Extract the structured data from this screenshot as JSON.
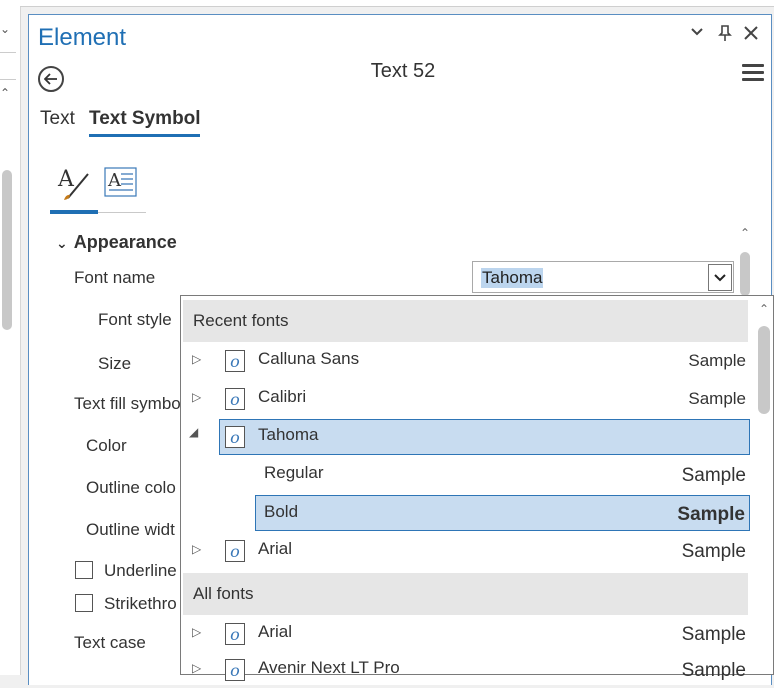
{
  "panel": {
    "title": "Element",
    "subtitle": "Text 52",
    "tabs": [
      {
        "label": "Text"
      },
      {
        "label": "Text Symbol"
      }
    ],
    "section": "Appearance",
    "properties": {
      "font_name": "Font name",
      "font_style": "Font style",
      "size": "Size",
      "text_fill_symbol": "Text fill symbo",
      "color": "Color",
      "outline_color": "Outline colo",
      "outline_width": "Outline widt",
      "underline": "Underline",
      "strikethrough": "Strikethro",
      "text_case": "Text case"
    },
    "font_combo_value": "Tahoma"
  },
  "dropdown": {
    "recent_header": "Recent fonts",
    "all_header": "All fonts",
    "recent": [
      {
        "name": "Calluna Sans",
        "sample": "Sample"
      },
      {
        "name": "Calibri",
        "sample": "Sample"
      },
      {
        "name": "Tahoma",
        "sample": ""
      },
      {
        "name": "Regular",
        "sample": "Sample"
      },
      {
        "name": "Bold",
        "sample": "Sample"
      },
      {
        "name": "Arial",
        "sample": "Sample"
      }
    ],
    "all": [
      {
        "name": "Arial",
        "sample": "Sample"
      },
      {
        "name": "Avenir Next LT Pro",
        "sample": "Sample"
      }
    ]
  },
  "icons": {
    "collapse": "chevron-down-icon",
    "pin": "pin-icon",
    "close": "close-icon",
    "back": "back-arrow-icon",
    "menu": "hamburger-menu-icon",
    "font": "font-icon-o"
  },
  "colors": {
    "accent": "#1f6fb4",
    "selection": "#c8dcf0",
    "selection_border": "#2e75b6"
  }
}
